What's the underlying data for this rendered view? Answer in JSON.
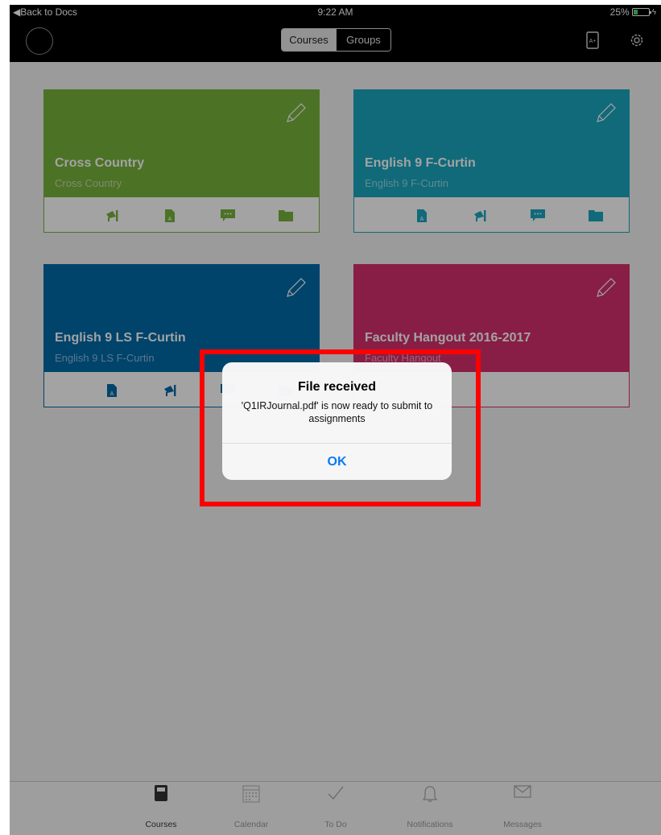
{
  "status": {
    "back": "◀Back to Docs",
    "time": "9:22 AM",
    "battery": "25%"
  },
  "nav": {
    "segments": [
      "Courses",
      "Groups"
    ],
    "active_segment": "Courses"
  },
  "cards": [
    {
      "title": "Cross Country",
      "subtitle": "Cross Country",
      "color": "#78b23c",
      "actions": [
        "megaphone-icon",
        "document-icon",
        "chat-icon",
        "folder-icon"
      ]
    },
    {
      "title": "English 9 F-Curtin",
      "subtitle": "English 9 F-Curtin",
      "color": "#1aa6bf",
      "actions": [
        "document-icon",
        "megaphone-icon",
        "chat-icon",
        "folder-icon"
      ]
    },
    {
      "title": "English 9 LS F-Curtin",
      "subtitle": "English 9 LS F-Curtin",
      "color": "#006aa8",
      "actions": [
        "document-icon",
        "megaphone-icon",
        "chat-icon",
        "folder-icon"
      ]
    },
    {
      "title": "Faculty Hangout 2016-2017",
      "subtitle": "Faculty Hangout",
      "color": "#d5306c",
      "actions": []
    }
  ],
  "dialog": {
    "title": "File received",
    "message": "'Q1IRJournal.pdf' is now ready to submit to assignments",
    "ok_label": "OK"
  },
  "tabs": [
    {
      "label": "Courses",
      "icon": "book-icon",
      "active": true
    },
    {
      "label": "Calendar",
      "icon": "calendar-icon",
      "active": false
    },
    {
      "label": "To Do",
      "icon": "checkmark-icon",
      "active": false
    },
    {
      "label": "Notifications",
      "icon": "bell-icon",
      "active": false
    },
    {
      "label": "Messages",
      "icon": "envelope-icon",
      "active": false
    }
  ]
}
